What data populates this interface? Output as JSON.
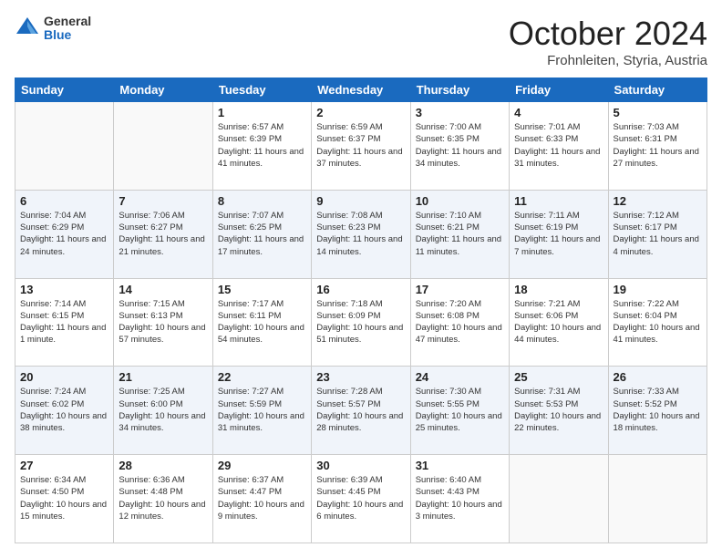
{
  "header": {
    "logo_general": "General",
    "logo_blue": "Blue",
    "month_title": "October 2024",
    "location": "Frohnleiten, Styria, Austria"
  },
  "weekdays": [
    "Sunday",
    "Monday",
    "Tuesday",
    "Wednesday",
    "Thursday",
    "Friday",
    "Saturday"
  ],
  "weeks": [
    [
      {
        "day": "",
        "info": ""
      },
      {
        "day": "",
        "info": ""
      },
      {
        "day": "1",
        "info": "Sunrise: 6:57 AM\nSunset: 6:39 PM\nDaylight: 11 hours and 41 minutes."
      },
      {
        "day": "2",
        "info": "Sunrise: 6:59 AM\nSunset: 6:37 PM\nDaylight: 11 hours and 37 minutes."
      },
      {
        "day": "3",
        "info": "Sunrise: 7:00 AM\nSunset: 6:35 PM\nDaylight: 11 hours and 34 minutes."
      },
      {
        "day": "4",
        "info": "Sunrise: 7:01 AM\nSunset: 6:33 PM\nDaylight: 11 hours and 31 minutes."
      },
      {
        "day": "5",
        "info": "Sunrise: 7:03 AM\nSunset: 6:31 PM\nDaylight: 11 hours and 27 minutes."
      }
    ],
    [
      {
        "day": "6",
        "info": "Sunrise: 7:04 AM\nSunset: 6:29 PM\nDaylight: 11 hours and 24 minutes."
      },
      {
        "day": "7",
        "info": "Sunrise: 7:06 AM\nSunset: 6:27 PM\nDaylight: 11 hours and 21 minutes."
      },
      {
        "day": "8",
        "info": "Sunrise: 7:07 AM\nSunset: 6:25 PM\nDaylight: 11 hours and 17 minutes."
      },
      {
        "day": "9",
        "info": "Sunrise: 7:08 AM\nSunset: 6:23 PM\nDaylight: 11 hours and 14 minutes."
      },
      {
        "day": "10",
        "info": "Sunrise: 7:10 AM\nSunset: 6:21 PM\nDaylight: 11 hours and 11 minutes."
      },
      {
        "day": "11",
        "info": "Sunrise: 7:11 AM\nSunset: 6:19 PM\nDaylight: 11 hours and 7 minutes."
      },
      {
        "day": "12",
        "info": "Sunrise: 7:12 AM\nSunset: 6:17 PM\nDaylight: 11 hours and 4 minutes."
      }
    ],
    [
      {
        "day": "13",
        "info": "Sunrise: 7:14 AM\nSunset: 6:15 PM\nDaylight: 11 hours and 1 minute."
      },
      {
        "day": "14",
        "info": "Sunrise: 7:15 AM\nSunset: 6:13 PM\nDaylight: 10 hours and 57 minutes."
      },
      {
        "day": "15",
        "info": "Sunrise: 7:17 AM\nSunset: 6:11 PM\nDaylight: 10 hours and 54 minutes."
      },
      {
        "day": "16",
        "info": "Sunrise: 7:18 AM\nSunset: 6:09 PM\nDaylight: 10 hours and 51 minutes."
      },
      {
        "day": "17",
        "info": "Sunrise: 7:20 AM\nSunset: 6:08 PM\nDaylight: 10 hours and 47 minutes."
      },
      {
        "day": "18",
        "info": "Sunrise: 7:21 AM\nSunset: 6:06 PM\nDaylight: 10 hours and 44 minutes."
      },
      {
        "day": "19",
        "info": "Sunrise: 7:22 AM\nSunset: 6:04 PM\nDaylight: 10 hours and 41 minutes."
      }
    ],
    [
      {
        "day": "20",
        "info": "Sunrise: 7:24 AM\nSunset: 6:02 PM\nDaylight: 10 hours and 38 minutes."
      },
      {
        "day": "21",
        "info": "Sunrise: 7:25 AM\nSunset: 6:00 PM\nDaylight: 10 hours and 34 minutes."
      },
      {
        "day": "22",
        "info": "Sunrise: 7:27 AM\nSunset: 5:59 PM\nDaylight: 10 hours and 31 minutes."
      },
      {
        "day": "23",
        "info": "Sunrise: 7:28 AM\nSunset: 5:57 PM\nDaylight: 10 hours and 28 minutes."
      },
      {
        "day": "24",
        "info": "Sunrise: 7:30 AM\nSunset: 5:55 PM\nDaylight: 10 hours and 25 minutes."
      },
      {
        "day": "25",
        "info": "Sunrise: 7:31 AM\nSunset: 5:53 PM\nDaylight: 10 hours and 22 minutes."
      },
      {
        "day": "26",
        "info": "Sunrise: 7:33 AM\nSunset: 5:52 PM\nDaylight: 10 hours and 18 minutes."
      }
    ],
    [
      {
        "day": "27",
        "info": "Sunrise: 6:34 AM\nSunset: 4:50 PM\nDaylight: 10 hours and 15 minutes."
      },
      {
        "day": "28",
        "info": "Sunrise: 6:36 AM\nSunset: 4:48 PM\nDaylight: 10 hours and 12 minutes."
      },
      {
        "day": "29",
        "info": "Sunrise: 6:37 AM\nSunset: 4:47 PM\nDaylight: 10 hours and 9 minutes."
      },
      {
        "day": "30",
        "info": "Sunrise: 6:39 AM\nSunset: 4:45 PM\nDaylight: 10 hours and 6 minutes."
      },
      {
        "day": "31",
        "info": "Sunrise: 6:40 AM\nSunset: 4:43 PM\nDaylight: 10 hours and 3 minutes."
      },
      {
        "day": "",
        "info": ""
      },
      {
        "day": "",
        "info": ""
      }
    ]
  ]
}
